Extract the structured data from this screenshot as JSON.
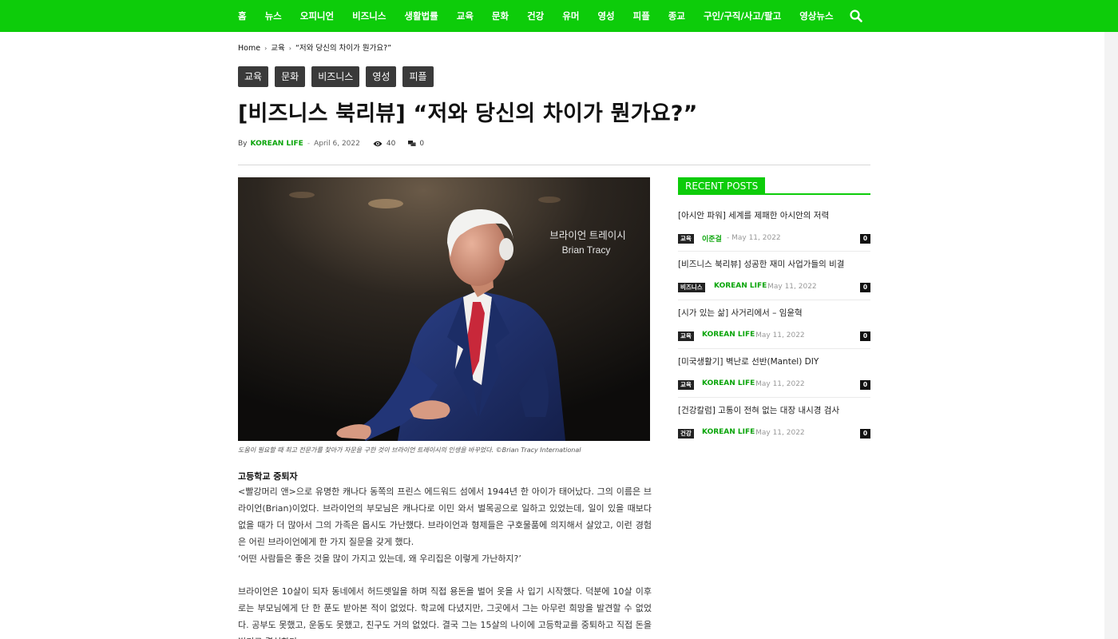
{
  "nav": {
    "items": [
      "홈",
      "뉴스",
      "오피니언",
      "비즈니스",
      "생활법률",
      "교육",
      "문화",
      "건강",
      "유머",
      "영성",
      "피플",
      "종교",
      "구인/구직/사고/팔고",
      "영상뉴스"
    ],
    "search_icon": "search-icon",
    "bg_color": "#0dcc0a"
  },
  "breadcrumb": {
    "home": "Home",
    "category": "교육",
    "current": "“저와 당신의 차이가 뭔가요?”"
  },
  "tags": [
    "교육",
    "문화",
    "비즈니스",
    "영성",
    "피플"
  ],
  "post": {
    "title": "[비즈니스 북리뷰] “저와 당신의 차이가 뭔가요?”",
    "by": "By",
    "author": "KOREAN LIFE",
    "date": "April 6, 2022",
    "views": "40",
    "comments": "0"
  },
  "image": {
    "overlay_name_ko": "브라이언 트레이시",
    "overlay_name_en": "Brian Tracy",
    "caption": "도움이 필요할 때 최고 전문가를 찾아가 자문을 구한 것이 브라이언 트레이시의 인생을 바꾸었다. ©Brian Tracy International"
  },
  "article": {
    "subheading": "고등학교 중퇴자",
    "p1": "<빨강머리 앤>으로 유명한 캐나다 동쪽의 프린스 에드워드 섬에서 1944년 한 아이가 태어났다. 그의 이름은 브라이언(Brian)이었다. 브라이언의 부모님은 캐나다로 이민 와서 벌목공으로 일하고 있었는데, 일이 있을 때보다 없을 때가 더 많아서 그의 가족은 몹시도 가난했다. 브라이언과 형제들은 구호물품에 의지해서 살았고, 이런 경험은 어린 브라이언에게 한 가지 질문을 갖게 했다.",
    "p1_quote": "‘어떤 사람들은 좋은 것을 많이 가지고 있는데, 왜 우리집은 이렇게 가난하지?’",
    "p2": "브라이언은 10살이 되자 동네에서 허드렛일을 하며 직접 용돈을 벌어 옷을 사 입기 시작했다. 덕분에 10살 이후로는 부모님에게 단 한 푼도 받아본 적이 없었다. 학교에 다녔지만, 그곳에서 그는 아무런 희망을 발견할 수 없었다. 공부도 못했고, 운동도 못했고, 친구도 거의 없었다. 결국 그는 15살의 나이에 고등학교를 중퇴하고 직접 돈을 벌기로 결심한다."
  },
  "sidebar": {
    "heading": "RECENT POSTS",
    "posts": [
      {
        "title": "[아시안 파워] 세계를 제패한 아시안의 저력",
        "category": "교육",
        "author": "이준걸",
        "date": "May 11, 2022",
        "comments": "0"
      },
      {
        "title": "[비즈니스 북리뷰] 성공한 재미 사업가들의 비결",
        "category": "비즈니스",
        "author": "KOREAN LIFE",
        "date": "May 11, 2022",
        "comments": "0"
      },
      {
        "title": "[시가 있는 삶] 사거리에서 – 임윤혁",
        "category": "교육",
        "author": "KOREAN LIFE",
        "date": "May 11, 2022",
        "comments": "0"
      },
      {
        "title": "[미국생활기] 벽난로 선반(Mantel) DIY",
        "category": "교육",
        "author": "KOREAN LIFE",
        "date": "May 11, 2022",
        "comments": "0"
      },
      {
        "title": "[건강칼럼] 고통이 전혀 없는 대장 내시경 검사",
        "category": "건강",
        "author": "KOREAN LIFE",
        "date": "May 11, 2022",
        "comments": "0"
      }
    ]
  }
}
